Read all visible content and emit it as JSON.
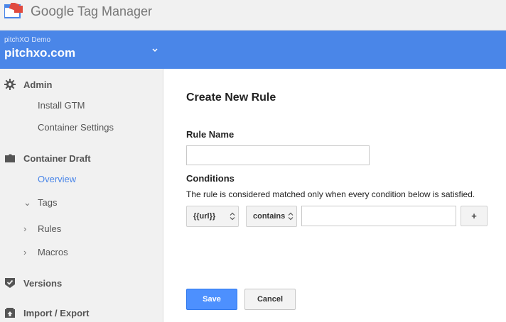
{
  "header": {
    "brand_google": "Google",
    "brand_product": "Tag Manager"
  },
  "account": {
    "name": "pitchXO Demo",
    "container": "pitchxo.com"
  },
  "sidebar": {
    "admin": {
      "label": "Admin",
      "items": [
        {
          "label": "Install GTM"
        },
        {
          "label": "Container Settings"
        }
      ]
    },
    "draft": {
      "label": "Container Draft",
      "items": [
        {
          "label": "Overview",
          "active": true
        },
        {
          "label": "Tags",
          "expander": "open"
        },
        {
          "label": "Rules",
          "expander": "closed"
        },
        {
          "label": "Macros",
          "expander": "closed"
        }
      ]
    },
    "versions": {
      "label": "Versions"
    },
    "import_export": {
      "label": "Import / Export"
    }
  },
  "form": {
    "title": "Create New Rule",
    "rule_name_label": "Rule Name",
    "rule_name_value": "",
    "conditions_label": "Conditions",
    "conditions_desc": "The rule is considered matched only when every condition below is satisfied.",
    "condition": {
      "macro": "{{url}}",
      "operator": "contains",
      "value": ""
    },
    "add_label": "+",
    "save_label": "Save",
    "cancel_label": "Cancel"
  },
  "colors": {
    "accent": "#4a86e8",
    "save_button": "#4d90fe",
    "sidebar_bg": "#f1f1f1"
  }
}
